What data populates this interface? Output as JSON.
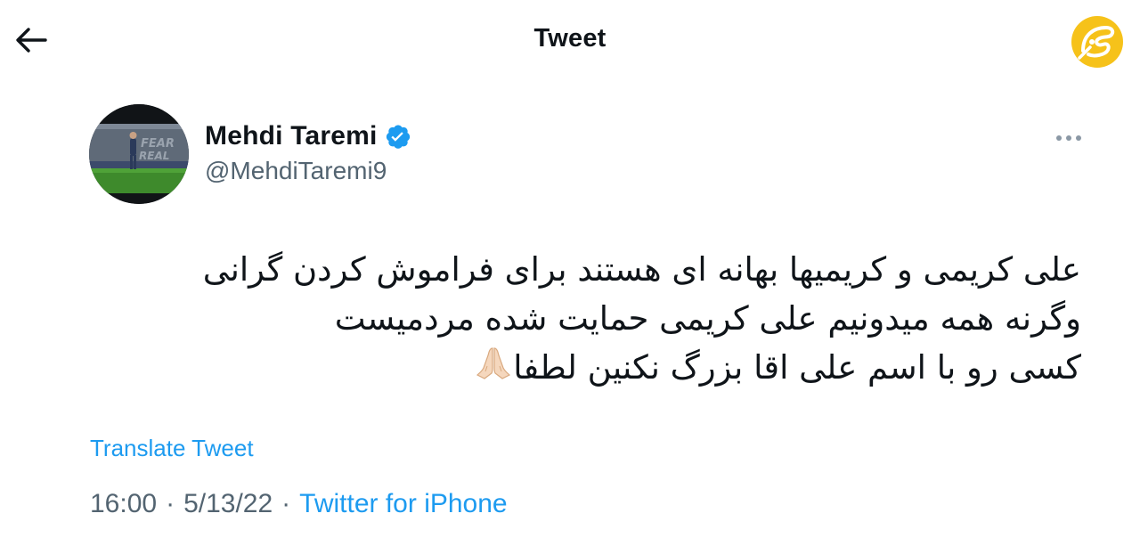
{
  "header": {
    "title": "Tweet",
    "back_icon": "arrow-left-icon",
    "logo_name": "publisher-logo",
    "logo_color": "#f6c21a"
  },
  "author": {
    "name": "Mehdi Taremi",
    "handle": "@MehdiTaremi9",
    "verified": true,
    "verified_color": "#1d9bf0"
  },
  "tweet": {
    "lines": [
      "علی کریمی و کریمیها بهانه ای هستند  برای فراموش کردن گرانی",
      "وگرنه همه میدونیم علی کریمی حمایت شده مردمیست",
      "کسی رو با اسم علی اقا بزرگ نکنین لطفا"
    ],
    "emoji": "🙏🏻",
    "translate_label": "Translate Tweet",
    "time": "16:00",
    "date": "5/13/22",
    "separator": "·",
    "source": "Twitter for iPhone"
  },
  "colors": {
    "text": "#0f1419",
    "secondary": "#536471",
    "link": "#1d9bf0"
  }
}
